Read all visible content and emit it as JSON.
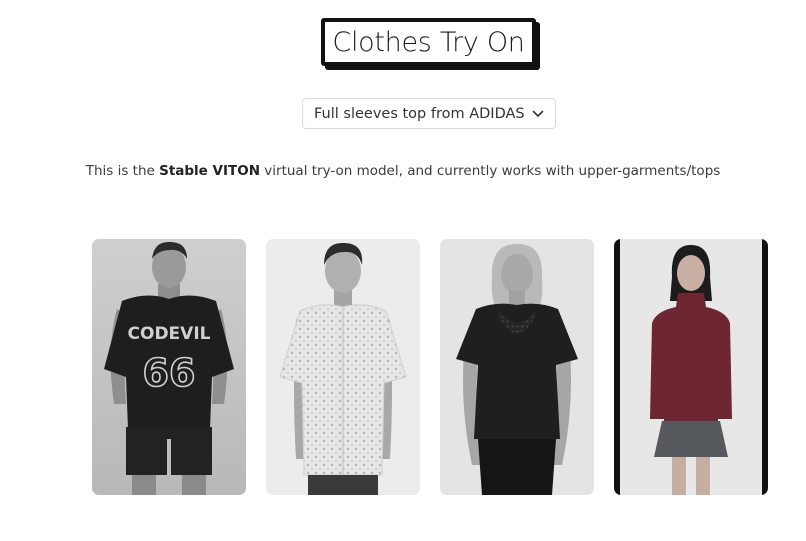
{
  "header": {
    "title": "Clothes Try On"
  },
  "garment_select": {
    "selected": "Full sleeves top from ADIDAS",
    "icon": "chevron-down-icon"
  },
  "description": {
    "prefix": "This is the ",
    "model_name": "Stable VITON",
    "suffix": " virtual try-on model, and currently works with upper-garments/tops"
  },
  "gallery": {
    "cards": [
      {
        "name": "model-card-jersey",
        "image": "man-in-black-jersey-66"
      },
      {
        "name": "model-card-shirt",
        "image": "man-in-printed-shirt"
      },
      {
        "name": "model-card-lace-top",
        "image": "woman-in-black-lace-top"
      },
      {
        "name": "model-card-maroon-top",
        "image": "woman-in-maroon-turtleneck"
      }
    ],
    "jersey_print": {
      "team": "CODEVIL",
      "number": "66"
    }
  },
  "colors": {
    "title_border": "#111111",
    "text": "#333333",
    "select_border": "#dcdcdc",
    "maroon_top": "#6e2632",
    "skirt": "#55585c"
  }
}
